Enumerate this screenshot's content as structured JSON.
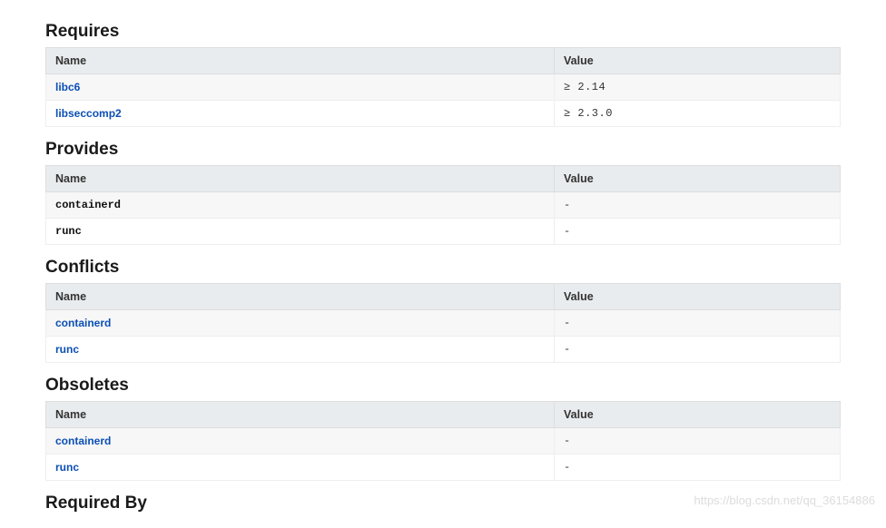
{
  "columns": {
    "name": "Name",
    "value": "Value"
  },
  "sections": {
    "requires": {
      "title": "Requires",
      "rows": [
        {
          "name": "libc6",
          "value": "≥ 2.14",
          "style": "link"
        },
        {
          "name": "libseccomp2",
          "value": "≥ 2.3.0",
          "style": "link"
        }
      ]
    },
    "provides": {
      "title": "Provides",
      "rows": [
        {
          "name": "containerd",
          "value": "-",
          "style": "mono"
        },
        {
          "name": "runc",
          "value": "-",
          "style": "mono"
        }
      ]
    },
    "conflicts": {
      "title": "Conflicts",
      "rows": [
        {
          "name": "containerd",
          "value": "-",
          "style": "link"
        },
        {
          "name": "runc",
          "value": "-",
          "style": "link"
        }
      ]
    },
    "obsoletes": {
      "title": "Obsoletes",
      "rows": [
        {
          "name": "containerd",
          "value": "-",
          "style": "link"
        },
        {
          "name": "runc",
          "value": "-",
          "style": "link"
        }
      ]
    },
    "required_by": {
      "title": "Required By"
    }
  },
  "watermark": "https://blog.csdn.net/qq_36154886"
}
